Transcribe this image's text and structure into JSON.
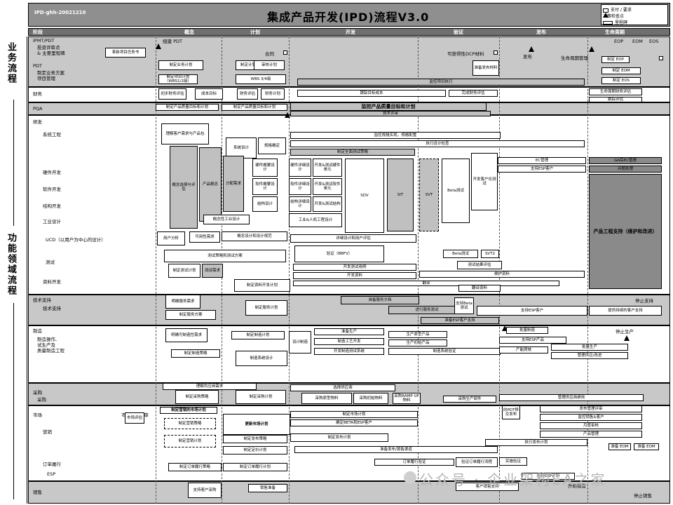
{
  "header": {
    "doc_id": "IPD-ghh-20021210",
    "title": "集成产品开发(IPD)流程V3.0",
    "legend": [
      "支付 / 要求",
      "决策检查点",
      "里程碑"
    ]
  },
  "phases": [
    "阶段",
    "概念",
    "计划",
    "开发",
    "验证",
    "发布",
    "生命周期"
  ],
  "left": {
    "business": "业务流程",
    "functional": "功能领域流程"
  },
  "lanes": {
    "ipmt": [
      "IPMT/PDT",
      "投资评审点",
      "& 主要里程碑",
      "PDT",
      "制定业务方案",
      "项目管理"
    ],
    "finance": "财务",
    "pqa": "PQA",
    "rnd": [
      "研发",
      "系统工程",
      "硬件开发",
      "软件开发",
      "结构开发",
      "工业设计",
      "UCD（以用户为中心的设计）",
      "测试",
      "资料开发"
    ],
    "tech": [
      "技术支持",
      "技术支持"
    ],
    "mfg": [
      "制造",
      "制造操作,",
      "试生产及",
      "质量制造工程"
    ],
    "proc": [
      "采购",
      "采购"
    ],
    "mkt": [
      "市场",
      "营销",
      "订单履行",
      "ESP",
      "市场管理评审"
    ],
    "sales": "销售"
  },
  "boxes": {
    "pdt_label": "组建 PDT",
    "b0": "革新项目任务书",
    "b1": "制定业务计划",
    "b2": "制定项目计划（WBS1/2级）",
    "b3": "制定计划",
    "b4": "审核计划",
    "b5": "WBS 3/4级",
    "contract": "合同",
    "dcp": "可获得性DCP材料",
    "b6": "准备发布材料",
    "b7": "监控项目执行",
    "release": "发布",
    "lifecycle": "生命周期管理",
    "b8": "制定 EOP",
    "b9": "制定 EOM",
    "b10": "制定 EOS",
    "eop": "EOP",
    "eom": "EOM",
    "eos": "EOS",
    "f0": "初步财务评估",
    "f1": "成本目标",
    "f2": "财务评估",
    "f3": "财务计划",
    "f4": "跟踪目标成本",
    "f5": "完成财务评估",
    "f6": "生命周期财务评估",
    "f7": "跟踪评估",
    "q0": "制定产品质量目标和计划",
    "q1": "制定产品质量目标和计划",
    "q2": "监控产品质量目标和计划",
    "q3": "技术评审",
    "r0": "理解客户需求与产品包",
    "r1": "监控规格实现，规格配置",
    "r2": "执行设计检查",
    "r3": "制定全面测试策略",
    "r4": "系统设计",
    "r5": "规格确定",
    "r6": "概念选择与评估",
    "r7": "产品概念",
    "r8": "分配需求",
    "r9": "硬件概要设计",
    "r10": "软件概要设计",
    "r11": "结构设计",
    "r12": "硬件详细设计",
    "r13": "开发&测试硬件单元",
    "r14": "软件详细设计",
    "r15": "开发&测试软件单元",
    "r16": "结构详细设计",
    "r17": "开发&测试结构",
    "r18": "工业&人机工程设计",
    "r19": "SDV",
    "r20": "SIT",
    "r21": "SVT",
    "r22": "Beta测试",
    "r23": "开发客户化测试",
    "r24": "概念性工业设计",
    "r25": "用户分析",
    "r26": "可用性需求",
    "r27": "概念设计和设计规范",
    "r28": "详细设计和用户评估",
    "r29": "测试策略和测试方案",
    "r30": "验证（BBFV）",
    "r31": "Beta测试",
    "r32": "SVT2",
    "r33": "制定测试计划",
    "r34": "测试需求",
    "r35": "开发测试用例",
    "r36": "测试结果评估",
    "r37": "开发资料",
    "r38": "维护资料",
    "r39": "制定资料开发计划",
    "r40": "翻译",
    "r41": "翻译资料",
    "r42": "EC管理",
    "r43": "支持ESP客户",
    "r44": "GA后EC管理",
    "r45": "问题处理",
    "r46": "产品工程支持（维护和改进）",
    "t0": "明确服务需求",
    "t1": "制定服务方案",
    "t2": "制定服务计划",
    "t3": "准备服务文档",
    "t4": "进行服务测试",
    "t5": "支持Beta测试",
    "t6": "支持ESP客户",
    "t7": "准备ESP客户支持",
    "t8": "提供持续的客户支持",
    "t9": "停止支持",
    "m0": "明确可制造性需求",
    "m1": "制定制造计划",
    "m2": "制定制造策略",
    "m3": "制造系统设计",
    "m4": "设计制造",
    "m5": "准备生产",
    "m6": "制造工艺开发",
    "m7": "开发制造测试系统",
    "m8": "生产原型产品",
    "m9": "生产初始产品",
    "m10": "制造系统验证",
    "m11": "批量制造",
    "m12": "支持ESP产品",
    "m13": "产能爬坡",
    "m14": "批量生产",
    "m15": "管理供应/改进",
    "m16": "停止生产",
    "p0": "理解供应商需求",
    "p1": "制定采购策略",
    "p2": "制定采购计划",
    "p3": "选择供应商",
    "p4": "采购原型物料",
    "p5": "采购初始物料",
    "p6": "采购RAMP UP物料",
    "p7": "采购生产部件",
    "p8": "管理供应商绩效",
    "k0": "制定营销的市场计划",
    "k1": "市场评估",
    "k2": "制定营销策略",
    "k3": "制定营销计划",
    "k4": "更新市场计划",
    "k5": "制定发布策略",
    "k6": "制定定价计划",
    "k7": "制定市场计划",
    "k8": "确定BETA和ESP客户",
    "k9": "制定发布计划",
    "k10": "准备发布/销售渠道",
    "k11": "向PDT移交发布",
    "k12": "发布管理评审",
    "k13": "监控销售&客户",
    "k14": "月度审核",
    "k15": "产品管理",
    "k16": "执行发布计划",
    "k17": "准备 EOM",
    "k18": "准备 EOM",
    "k19": "制定订单履行策略",
    "k20": "制定订单履行计划",
    "k21": "订单履行验证",
    "k22": "验证订单履行流程",
    "k23": "实施验证",
    "s0": "支持客户采购",
    "s1": "销售准备",
    "s2": "客户销售支持",
    "s3": "执行ESP计划",
    "s4": "开始销售",
    "s5": "停止销售"
  },
  "watermark": "公众号 · 企业架构EA之家"
}
